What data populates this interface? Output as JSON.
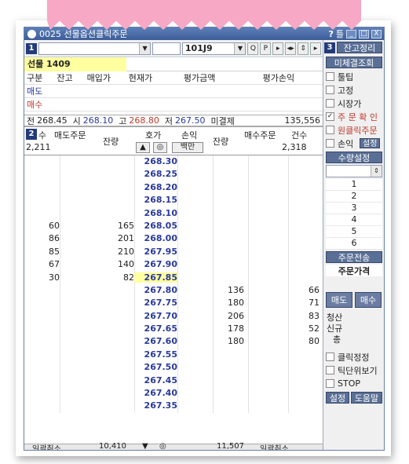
{
  "window": {
    "title": "0025 선물옵션클릭주문",
    "title_buttons": [
      "?",
      "틀",
      "_",
      "□",
      "X"
    ]
  },
  "toolbar": {
    "section_num": "1",
    "account_value": "",
    "password_value": "",
    "code_value": "101J9",
    "q_label": "Q",
    "p_label": "P"
  },
  "product": {
    "name": "선물 1409"
  },
  "balance": {
    "headers": [
      "구분",
      "잔고",
      "매입가",
      "현재가",
      "평가금액",
      "평가손익"
    ],
    "rows": [
      {
        "label": "매도"
      },
      {
        "label": "매수"
      }
    ]
  },
  "quote": {
    "prev_label": "전",
    "prev": "268.45",
    "open_label": "시",
    "open": "268.10",
    "high_label": "고",
    "high": "268.80",
    "low_label": "저",
    "low": "267.50",
    "oi_label": "미결제",
    "oi": "135,556"
  },
  "book_header": {
    "section_num": "2",
    "col_count": "수",
    "col_sell_order": "매도주문",
    "col_sell_rem": "잔량",
    "col_price": "호가",
    "col_pl": "손익",
    "col_pl_btn": "백만",
    "col_buy_rem": "잔량",
    "col_buy_order": "매수주문",
    "col_buy_count": "건수",
    "sell_count_total": "2,211",
    "buy_count_total": "2,318"
  },
  "book_rows": [
    {
      "price": "268.30",
      "sq": "",
      "sr": "",
      "br": "",
      "bc": ""
    },
    {
      "price": "268.25",
      "sq": "",
      "sr": "",
      "br": "",
      "bc": ""
    },
    {
      "price": "268.20",
      "sq": "",
      "sr": "",
      "br": "",
      "bc": ""
    },
    {
      "price": "268.15",
      "sq": "",
      "sr": "",
      "br": "",
      "bc": ""
    },
    {
      "price": "268.10",
      "sq": "",
      "sr": "",
      "br": "",
      "bc": ""
    },
    {
      "price": "268.05",
      "sq": "60",
      "sr": "165",
      "br": "",
      "bc": ""
    },
    {
      "price": "268.00",
      "sq": "86",
      "sr": "201",
      "br": "",
      "bc": ""
    },
    {
      "price": "267.95",
      "sq": "85",
      "sr": "210",
      "br": "",
      "bc": ""
    },
    {
      "price": "267.90",
      "sq": "67",
      "sr": "140",
      "br": "",
      "bc": ""
    },
    {
      "price": "267.85",
      "sq": "30",
      "sr": "82",
      "br": "",
      "bc": "",
      "current": true
    },
    {
      "price": "267.80",
      "sq": "",
      "sr": "",
      "br": "136",
      "bc": "66"
    },
    {
      "price": "267.75",
      "sq": "",
      "sr": "",
      "br": "180",
      "bc": "71"
    },
    {
      "price": "267.70",
      "sq": "",
      "sr": "",
      "br": "206",
      "bc": "83"
    },
    {
      "price": "267.65",
      "sq": "",
      "sr": "",
      "br": "178",
      "bc": "52"
    },
    {
      "price": "267.60",
      "sq": "",
      "sr": "",
      "br": "180",
      "bc": "80"
    },
    {
      "price": "267.55",
      "sq": "",
      "sr": "",
      "br": "",
      "bc": ""
    },
    {
      "price": "267.50",
      "sq": "",
      "sr": "",
      "br": "",
      "bc": ""
    },
    {
      "price": "267.45",
      "sq": "",
      "sr": "",
      "br": "",
      "bc": ""
    },
    {
      "price": "267.40",
      "sq": "",
      "sr": "",
      "br": "",
      "bc": ""
    },
    {
      "price": "267.35",
      "sq": "",
      "sr": "",
      "br": "",
      "bc": ""
    }
  ],
  "footer": {
    "sell_total": "10,410",
    "buy_total": "11,507",
    "left_btn": "일괄취소",
    "right_btn": "일괄취소"
  },
  "side": {
    "section_num": "3",
    "btn_balance": "잔고정리",
    "btn_unsettled": "미체결조회",
    "checks": [
      {
        "label": "툴팁",
        "checked": false
      },
      {
        "label": "고정",
        "checked": false
      },
      {
        "label": "시장가",
        "checked": false
      },
      {
        "label": "주 문 확 인",
        "checked": true
      },
      {
        "label": "원클릭주문",
        "checked": false
      },
      {
        "label": "손익",
        "checked": false
      }
    ],
    "settings_small": "설정",
    "qty_setting": "수량설정",
    "qty_list": [
      "1",
      "2",
      "3",
      "4",
      "5",
      "6"
    ],
    "order_send": "주문전송",
    "order_price": "주문가격",
    "sell_btn": "매도",
    "buy_btn": "매수",
    "liq_label": "청산",
    "new_label": "신규",
    "total_label": "총",
    "checks2": [
      {
        "label": "클릭정정",
        "checked": false
      },
      {
        "label": "틱단위보기",
        "checked": false
      },
      {
        "label": "STOP",
        "checked": false
      }
    ],
    "settings_btn": "설정",
    "help_btn": "도움말"
  },
  "colors": {
    "accent": "#3c5d98",
    "price_text": "#2a3a9a",
    "up": "#c0392b",
    "highlight": "#ffffa0"
  }
}
